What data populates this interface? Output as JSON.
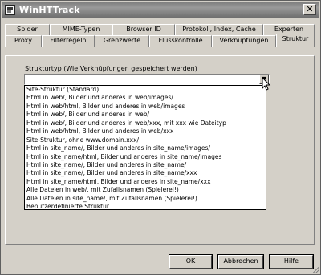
{
  "window": {
    "title": "WinHTTrack",
    "icons": {
      "app": "app-icon",
      "close": "close-icon"
    },
    "close_glyph": "✕"
  },
  "tabs": {
    "row1": [
      "Spider",
      "MIME-Typen",
      "Browser ID",
      "Protokoll, Index, Cache",
      "Experten"
    ],
    "row2": [
      "Proxy",
      "Filterregeln",
      "Grenzwerte",
      "Flusskontrolle",
      "Verknüpfungen",
      "Struktur"
    ],
    "active": "Struktur"
  },
  "structure": {
    "label": "Strukturtyp (Wie Verknüpfungen gespeichert werden)",
    "selected_value": "",
    "dropdown_glyph": "▼",
    "options": [
      "Site-Struktur (Standard)",
      "Html in web/, Bilder und anderes in web/images/",
      "Html in web/html, Bilder und anderes in web/images",
      "Html in web/, Bilder und anderes in web/",
      "Html in web/, Bilder und anderes in web/xxx, mit xxx wie Dateityp",
      "Html in web/html, Bilder und anderes in web/xxx",
      "Site-Struktur, ohne www.domain.xxx/",
      "Html in site_name/, Bilder und anderes in site_name/images/",
      "Html in site_name/html, Bilder und anderes in site_name/images",
      "Html in site_name/, Bilder und anderes in site_name/",
      "Html in site_name/, Bilder und anderes in site_name/xxx",
      "Html in site_name/html, Bilder und anderes in site_name/xxx",
      "Alle Dateien in web/, mit Zufallsnamen (Spielerei!)",
      "Alle Dateien in site_name/, mit Zufallsnamen (Spielerei!)",
      "Benutzerdefinierte Struktur..."
    ]
  },
  "buttons": {
    "ok": "OK",
    "cancel": "Abbrechen",
    "help": "Hilfe"
  },
  "colors": {
    "face": "#d4d0c8",
    "titlebar": "#7a7a7a",
    "title_text": "#ffffff"
  }
}
